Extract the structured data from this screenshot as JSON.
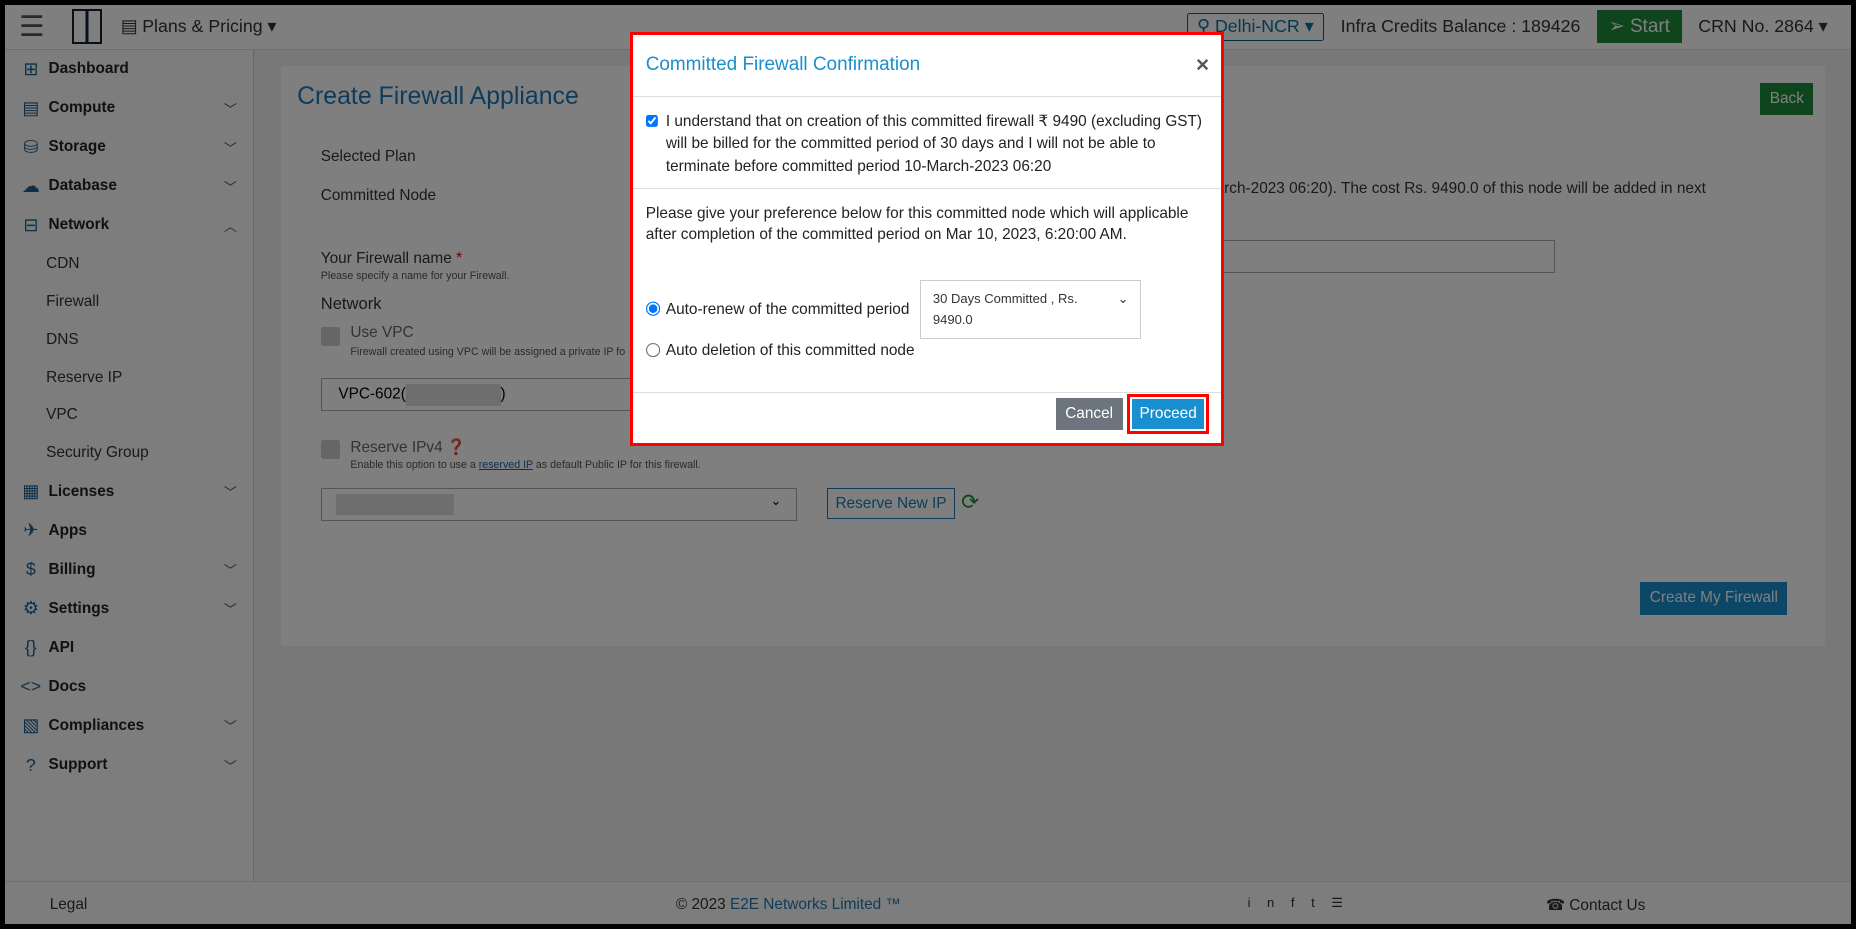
{
  "topbar": {
    "menu_icon": "hamburger-icon",
    "plans": "Plans & Pricing",
    "region": "Delhi-NCR",
    "credits": "Infra Credits Balance : 189426",
    "start": "Start",
    "crn": "CRN No. 2864"
  },
  "sidebar": {
    "items": [
      {
        "label": "Dashboard",
        "icon": "dashboard-icon",
        "expand": ""
      },
      {
        "label": "Compute",
        "icon": "compute-icon",
        "expand": "down"
      },
      {
        "label": "Storage",
        "icon": "storage-icon",
        "expand": "down"
      },
      {
        "label": "Database",
        "icon": "database-icon",
        "expand": "down"
      },
      {
        "label": "Network",
        "icon": "network-icon",
        "expand": "up"
      }
    ],
    "network_sub": [
      "CDN",
      "Firewall",
      "DNS",
      "Reserve IP",
      "VPC",
      "Security Group"
    ],
    "items2": [
      {
        "label": "Licenses",
        "icon": "licenses-icon",
        "expand": "down"
      },
      {
        "label": "Apps",
        "icon": "rocket-icon",
        "expand": ""
      },
      {
        "label": "Billing",
        "icon": "billing-icon",
        "expand": "down"
      },
      {
        "label": "Settings",
        "icon": "gear-icon",
        "expand": "down"
      },
      {
        "label": "API",
        "icon": "braces-icon",
        "expand": ""
      },
      {
        "label": "Docs",
        "icon": "code-icon",
        "expand": ""
      },
      {
        "label": "Compliances",
        "icon": "document-icon",
        "expand": "down"
      },
      {
        "label": "Support",
        "icon": "support-icon",
        "expand": "down"
      }
    ]
  },
  "main": {
    "title": "Create Firewall Appliance",
    "back": "Back",
    "selected_plan": "Selected Plan",
    "committed_node": "Committed Node",
    "committed_text": "arch-2023 06:20). The cost Rs. 9490.0 of this node will be added in next",
    "fw_name": "Your Firewall name",
    "required": "*",
    "fw_hint": "Please specify a name for your Firewall.",
    "network": "Network",
    "use_vpc": "Use VPC",
    "vpc_hint": "Firewall created using VPC will be assigned a private IP fo",
    "vpc_value": "VPC-602(",
    "vpc_suffix": ")",
    "reserve_ipv4": "Reserve IPv4",
    "reserve_hint_a": "Enable this option to use a",
    "reserve_hint_link": "reserved IP",
    "reserve_hint_b": "as default Public IP for this firewall.",
    "reserve_new": "Reserve New IP",
    "create": "Create My Firewall"
  },
  "footer": {
    "legal": "Legal",
    "copyright": "© 2023",
    "company": "E2E Networks Limited ™",
    "contact": "Contact Us"
  },
  "modal": {
    "title": "Committed Firewall Confirmation",
    "close": "×",
    "agree": "I understand that on creation of this committed firewall ₹ 9490 (excluding GST) will be billed for the committed period of 30 days and I will not be able to terminate before committed period 10-March-2023 06:20",
    "agree_checked": true,
    "preference": "Please give your preference below for this committed node which will applicable after completion of the committed period on Mar 10, 2023, 6:20:00 AM.",
    "auto_renew": "Auto-renew of the committed period",
    "auto_renew_selected": true,
    "plan_option": "30 Days Committed , Rs. 9490.0",
    "auto_delete": "Auto deletion of this committed node",
    "cancel": "Cancel",
    "proceed": "Proceed"
  },
  "colors": {
    "accent": "#1a8fd0",
    "green": "#1d8a3a",
    "highlight": "#ff0000"
  }
}
